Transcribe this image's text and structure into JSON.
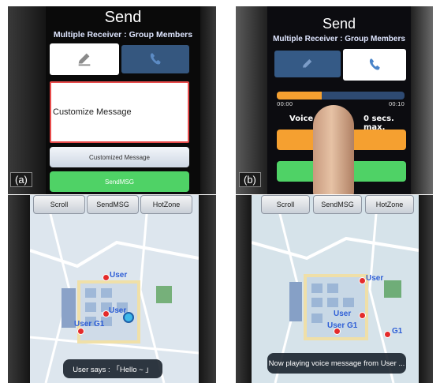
{
  "panel_a": {
    "label": "(a)",
    "title": "Send",
    "subtitle": "Multiple Receiver : Group Members",
    "tabs": [
      {
        "icon": "pencil-icon"
      },
      {
        "icon": "phone-icon"
      }
    ],
    "message_placeholder": "Customize Message",
    "customized_button": "Customized Message",
    "send_button": "SendMSG"
  },
  "panel_b": {
    "label": "(b)",
    "title": "Send",
    "subtitle": "Multiple Receiver : Group Members",
    "tabs": [
      {
        "icon": "pencil-icon"
      },
      {
        "icon": "phone-icon"
      }
    ],
    "time_start": "00:00",
    "time_end": "00:10",
    "recording_progress": 0.35,
    "voice_limit_text": "Voice m",
    "voice_limit_text_end": "0 secs. max."
  },
  "panel_c": {
    "toolbar": [
      "Scroll",
      "SendMSG",
      "HotZone"
    ],
    "markers": [
      "User",
      "User",
      "User G1"
    ],
    "toast": "User says : 「Hello ~ 」"
  },
  "panel_d": {
    "toolbar": [
      "Scroll",
      "SendMSG",
      "HotZone"
    ],
    "markers": [
      "User",
      "User",
      "User G1",
      "G1"
    ],
    "toast": "Now playing voice message from User ..."
  },
  "colors": {
    "accent_red": "#e84c4c",
    "send_green": "#4fd266",
    "orange": "#f5a030",
    "progress_blue": "#3b7bd0"
  }
}
